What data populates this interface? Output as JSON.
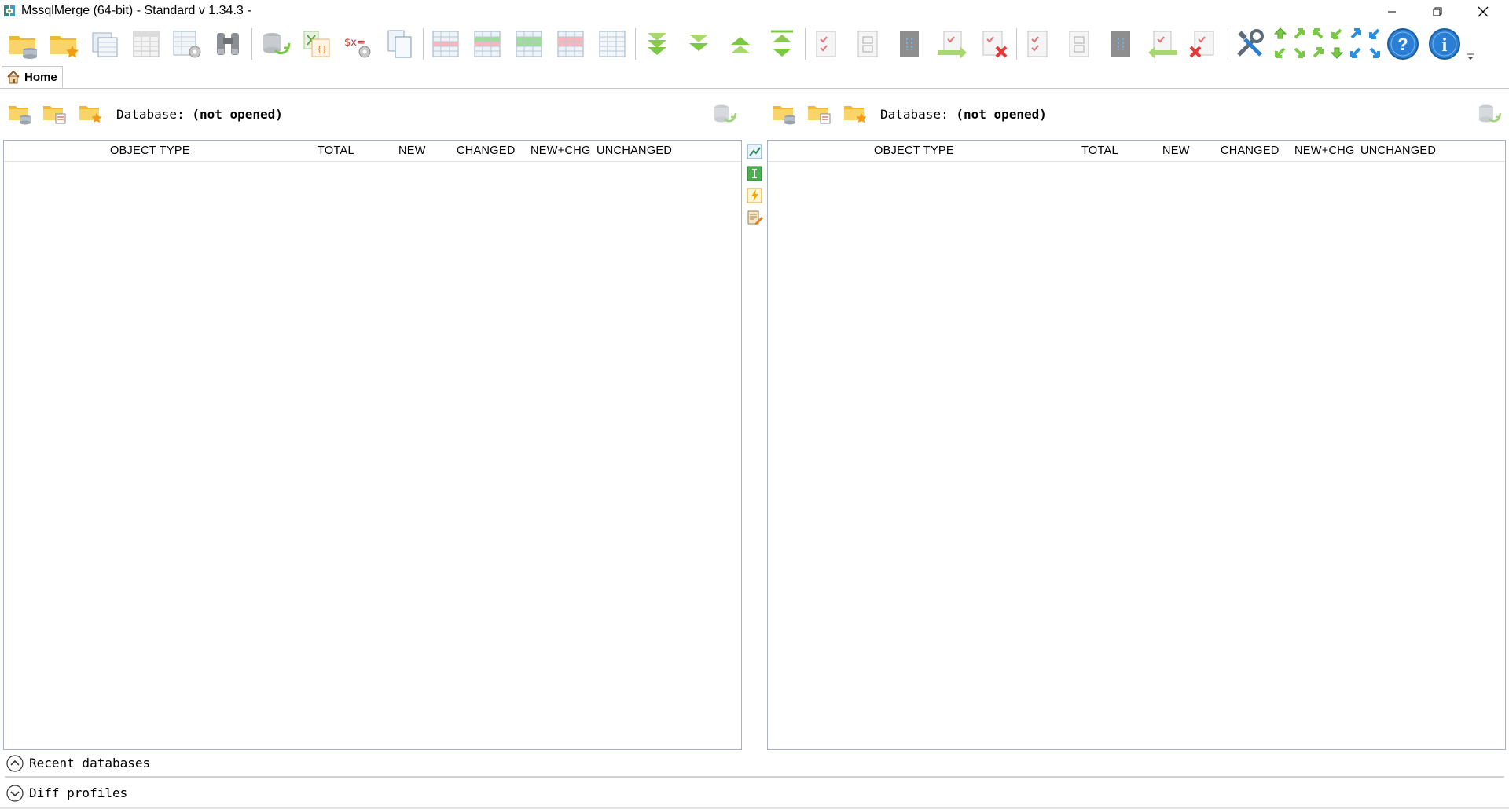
{
  "window": {
    "title": "MssqlMerge (64-bit) - Standard v 1.34.3 -",
    "controls": [
      "minimize-icon",
      "restore-icon",
      "close-icon"
    ]
  },
  "toolbar": {
    "buttons": [
      "open-database-icon",
      "open-favorite-icon",
      "copy-windows-icon",
      "table-data-icon",
      "table-settings-icon",
      "binoculars-icon",
      "refresh-compare-icon",
      "export-excel-icon",
      "sql-settings-icon",
      "copy-document-icon",
      "grid-all-icon",
      "grid-changed-icon",
      "grid-new-icon",
      "grid-deleted-icon",
      "grid-plain-icon",
      "expand-all-icon",
      "expand-down-icon",
      "collapse-up-icon",
      "collapse-all-icon",
      "check-doc-icon",
      "split-doc-icon",
      "link-doc-icon",
      "merge-right-icon",
      "delete-check-icon",
      "check-doc-2-icon",
      "split-doc-2-icon",
      "link-doc-2-icon",
      "merge-left-icon",
      "delete-check-2-icon",
      "tools-icon",
      "help-icon",
      "info-icon"
    ],
    "nav_arrows": [
      "arrow-up-green-icon",
      "arrow-up-green-icon",
      "arrow-up-green-icon",
      "arrow-up-green-icon",
      "arrow-up-blue-icon",
      "arrow-up-blue-icon",
      "arrow-down-green-icon",
      "arrow-down-green-icon",
      "arrow-down-green-icon",
      "arrow-down-green-icon",
      "arrow-down-blue-icon",
      "arrow-down-blue-icon"
    ]
  },
  "tabs": [
    {
      "label": "Home",
      "icon": "home-icon",
      "active": true
    }
  ],
  "left_panel": {
    "db_label": "Database:",
    "db_value": "(not opened)",
    "columns": [
      "OBJECT TYPE",
      "TOTAL",
      "NEW",
      "CHANGED",
      "NEW+CHG",
      "UNCHANGED"
    ],
    "rows": []
  },
  "right_panel": {
    "db_label": "Database:",
    "db_value": "(not opened)",
    "columns": [
      "OBJECT TYPE",
      "TOTAL",
      "NEW",
      "CHANGED",
      "NEW+CHG",
      "UNCHANGED"
    ],
    "rows": []
  },
  "middle_tools": [
    "compare-icon",
    "info-green-icon",
    "lightning-icon",
    "script-edit-icon"
  ],
  "bottom": {
    "recent_databases": "Recent databases",
    "diff_profiles": "Diff profiles"
  },
  "colors": {
    "folder": "#f5c242",
    "green": "#7ac943",
    "blue": "#2a7fd4",
    "border": "#a9b4c2"
  }
}
